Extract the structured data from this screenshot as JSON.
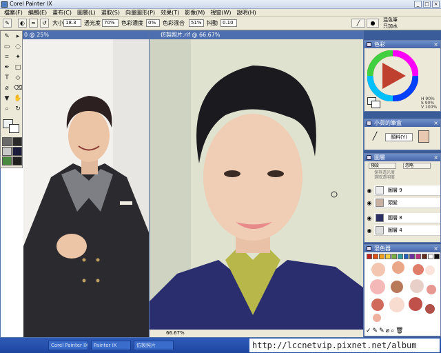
{
  "window": {
    "title": "Corel Painter IX"
  },
  "menu": [
    "檔案(F)",
    "編輯(E)",
    "畫布(C)",
    "圖層(L)",
    "選取(S)",
    "向量圖形(P)",
    "效果(T)",
    "影像(M)",
    "視窗(W)",
    "說明(H)"
  ],
  "propbar": {
    "size_label": "大小",
    "size_value": "18.3",
    "opacity_label": "透光度",
    "opacity_value": "70%",
    "resat_label": "色彩濃度",
    "resat_value": "0%",
    "bleed_label": "色彩混合",
    "bleed_value": "51%",
    "jitter_label": "抖動",
    "jitter_value": "0.10",
    "brush_category": "混色筆",
    "brush_variant": "只加水"
  },
  "doc1": {
    "title": "0 @ 25%"
  },
  "doc2": {
    "title": "仿製照片.rif @ 66.67%",
    "zoom": "66.67%"
  },
  "panels": {
    "color": {
      "title": "色彩",
      "readout": [
        "H 90%",
        "S 90%",
        "V 100%"
      ]
    },
    "mixer": {
      "title": "小貨的筆盒",
      "item": "顏料(Y)"
    },
    "layers": {
      "title": "圖層",
      "mode": "預設",
      "opacity_label": "忽略",
      "opts": [
        "保持透光度",
        "選取透明度"
      ],
      "rows": [
        "圖層 9",
        "頭髮",
        "圖層 8",
        "圖層 4"
      ]
    },
    "swatches": {
      "title": "混色器",
      "top_colors": [
        "#c42020",
        "#e85010",
        "#f0a020",
        "#f4d040",
        "#7ab040",
        "#2aa0a0",
        "#2060c0",
        "#7030a0",
        "#c03080",
        "#603020",
        "#ffffff",
        "#101010"
      ],
      "blobs": [
        "#f2c6b0",
        "#eaa888",
        "#e07c6a",
        "#f4b8b8",
        "#b87a5a",
        "#e8d0c8",
        "#d06a5a",
        "#f8dcd0",
        "#c0504a",
        "#e89890",
        "#fce4dc",
        "#b05048",
        "#f0b0a0"
      ]
    }
  },
  "taskbar": {
    "items": [
      "Corel Painter IX",
      "Painter IX",
      "仿製照片"
    ]
  },
  "watermark": "http://lccnetvip.pixnet.net/album"
}
